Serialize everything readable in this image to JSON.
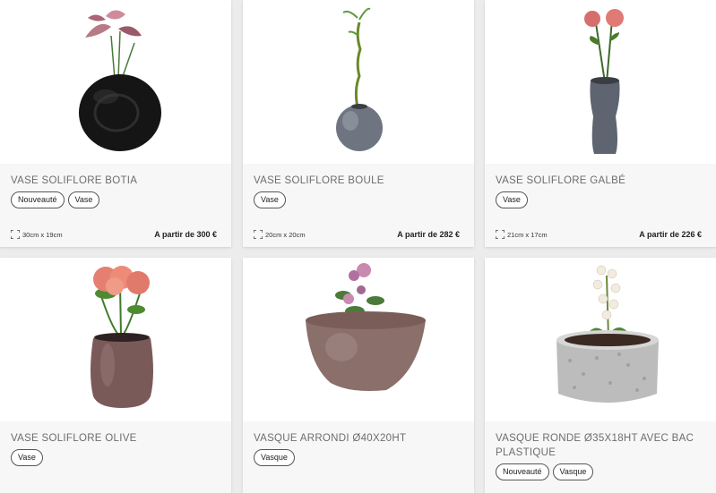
{
  "products": [
    {
      "title": "VASE SOLIFLORE BOTIA",
      "tags": [
        "Nouveauté",
        "Vase"
      ],
      "dimensions": "30cm x 19cm",
      "price": "A partir de 300 €",
      "image_icon": "black-round-vase-with-flowers"
    },
    {
      "title": "VASE SOLIFLORE BOULE",
      "tags": [
        "Vase"
      ],
      "dimensions": "20cm x 20cm",
      "price": "A partir de 282 €",
      "image_icon": "grey-ball-vase-with-bamboo"
    },
    {
      "title": "VASE SOLIFLORE GALBÉ",
      "tags": [
        "Vase"
      ],
      "dimensions": "21cm x 17cm",
      "price": "A partir de 226 €",
      "image_icon": "tall-grey-vase-with-roses"
    },
    {
      "title": "VASE SOLIFLORE OLIVE",
      "tags": [
        "Vase"
      ],
      "image_icon": "brown-olive-vase-with-roses"
    },
    {
      "title": "VASQUE ARRONDI Ø40X20HT",
      "tags": [
        "Vasque"
      ],
      "image_icon": "round-bowl-planter-with-roses"
    },
    {
      "title": "VASQUE RONDE Ø35X18HT AVEC BAC PLASTIQUE",
      "tags": [
        "Nouveauté",
        "Vasque"
      ],
      "image_icon": "granite-round-planter-with-orchid"
    }
  ]
}
